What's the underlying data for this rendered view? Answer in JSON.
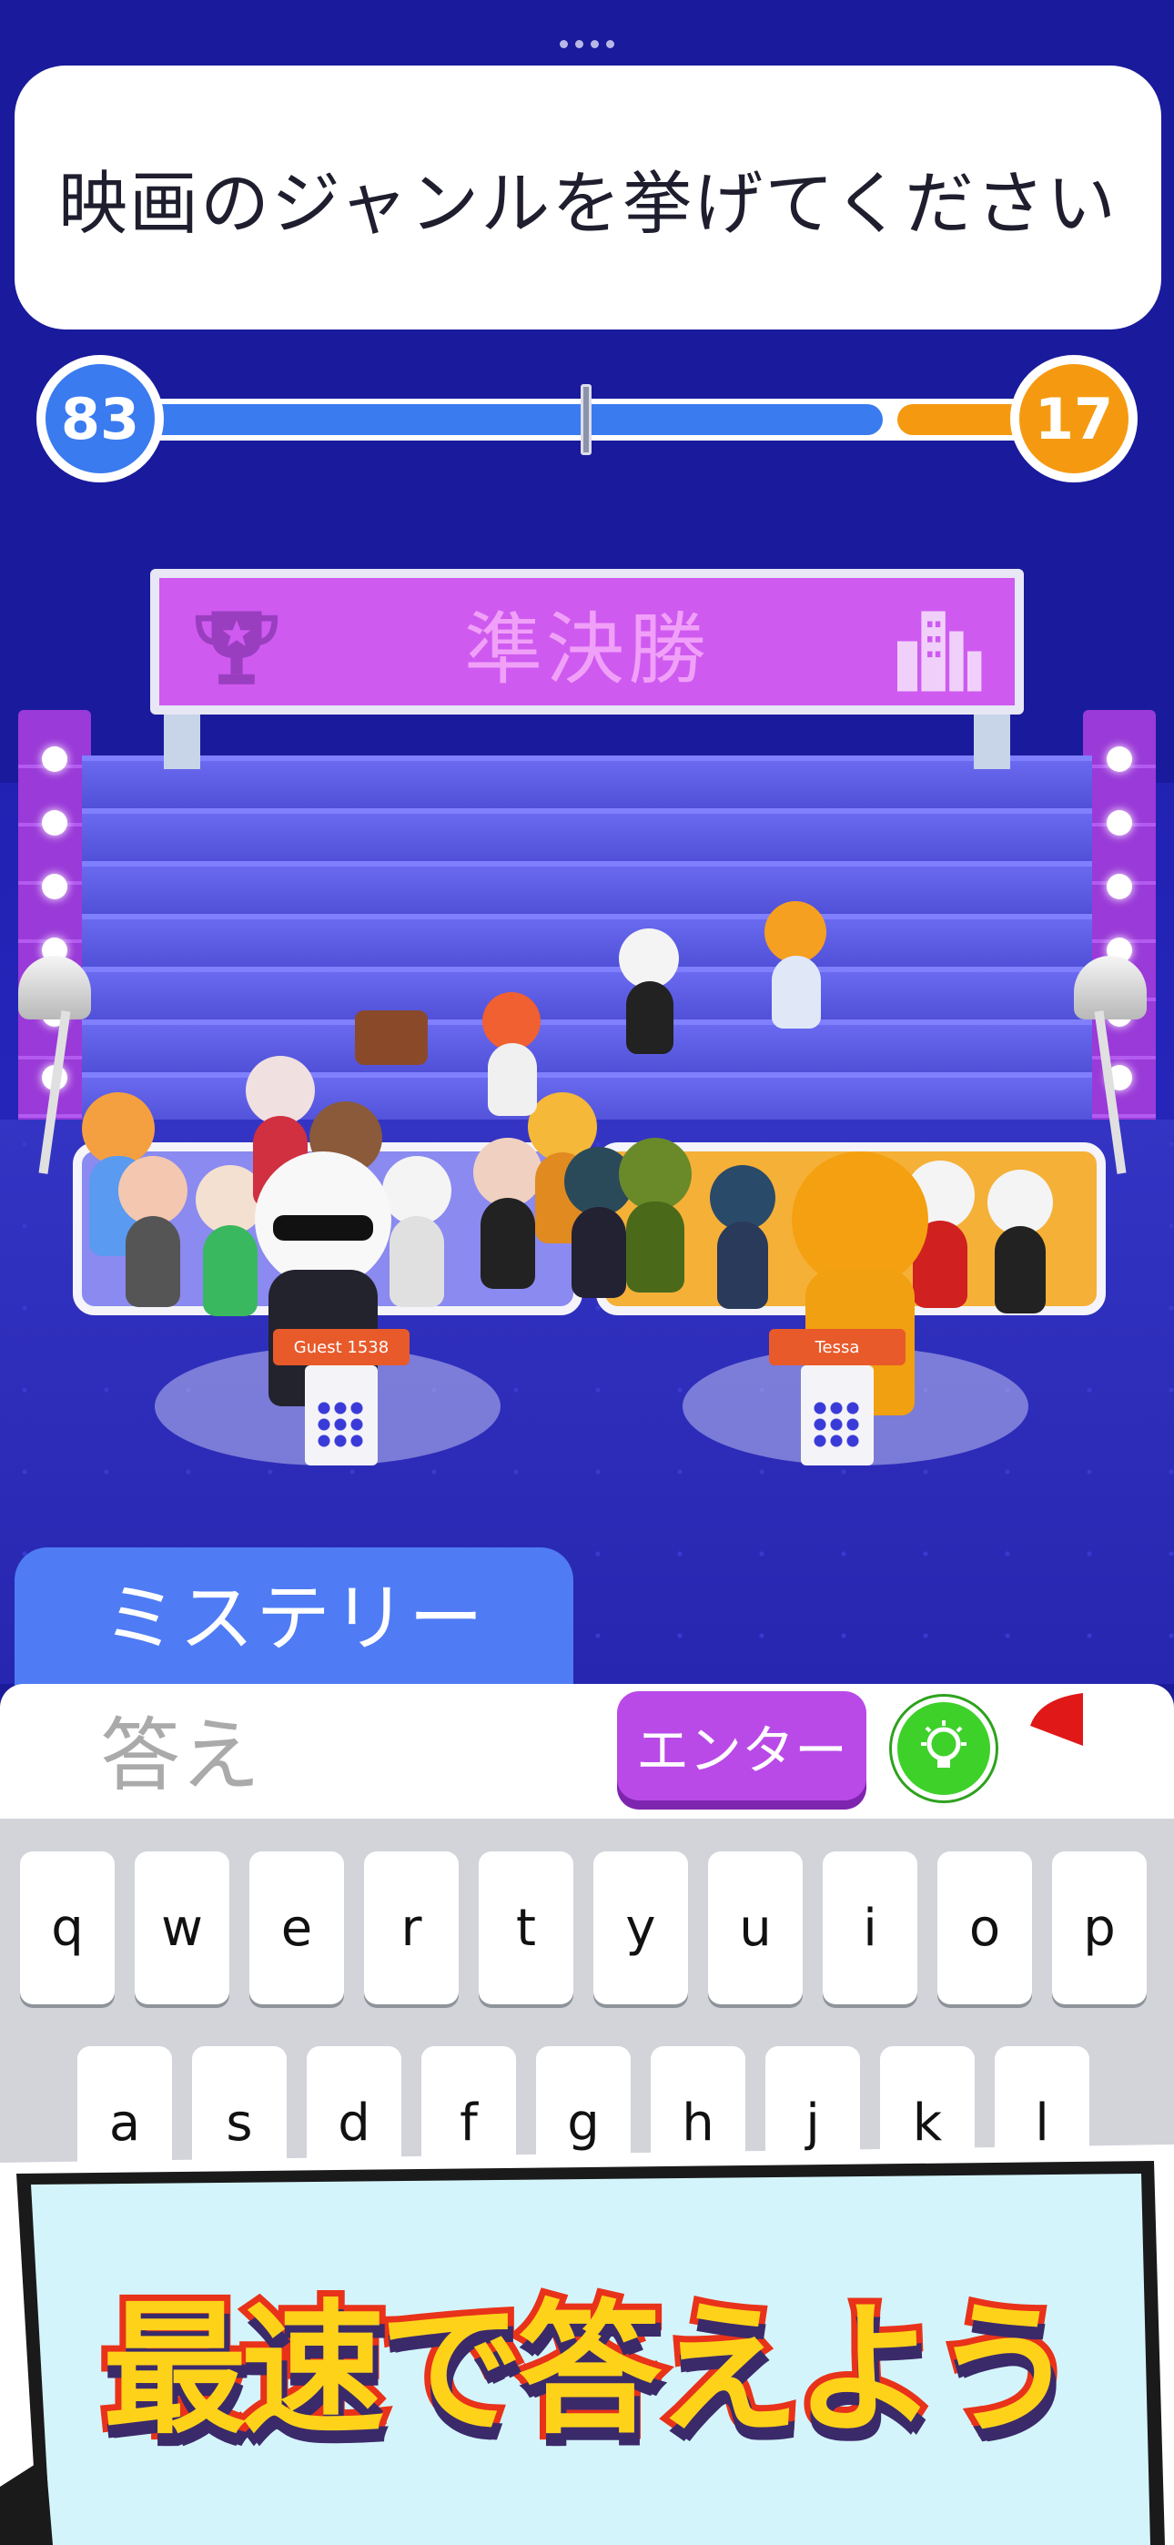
{
  "question": {
    "text": "映画のジャンルを挙げてください"
  },
  "score": {
    "left": "83",
    "right": "17",
    "left_fraction": 0.83,
    "right_fraction": 0.17,
    "left_color": "#3a7bf0",
    "right_color": "#f59a10"
  },
  "round": {
    "title": "準決勝"
  },
  "players": {
    "left_name": "Guest 1538",
    "right_name": "Tessa"
  },
  "category": {
    "label": "ミステリー"
  },
  "answer": {
    "placeholder": "答え",
    "enter_label": "エンター"
  },
  "keyboard": {
    "row1": [
      "q",
      "w",
      "e",
      "r",
      "t",
      "y",
      "u",
      "i",
      "o",
      "p"
    ],
    "row2": [
      "a",
      "s",
      "d",
      "f",
      "g",
      "h",
      "j",
      "k",
      "l"
    ]
  },
  "promo": {
    "text": "最速で答えよう"
  },
  "icons": {
    "trophy": "trophy-icon",
    "city": "city-icon",
    "hint": "lightbulb-icon",
    "timer": "timer-icon"
  }
}
